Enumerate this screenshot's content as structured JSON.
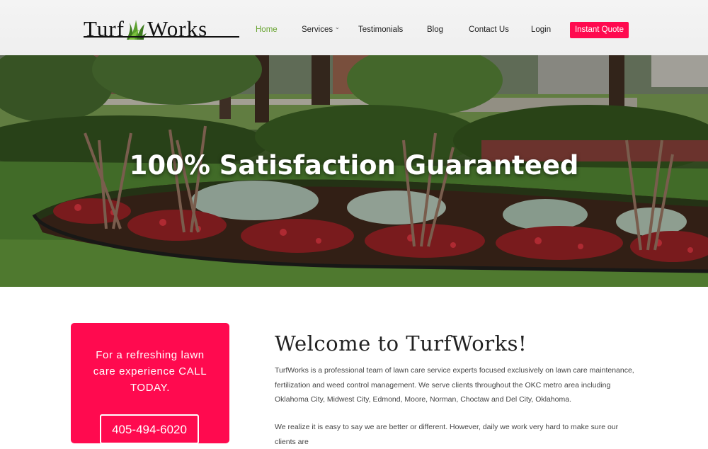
{
  "header": {
    "logo_left": "Turf",
    "logo_right": "Works",
    "nav": [
      {
        "label": "Home",
        "active": true
      },
      {
        "label": "Services",
        "has_dropdown": true
      },
      {
        "label": "Testimonials"
      },
      {
        "label": "Blog"
      },
      {
        "label": "Contact Us"
      },
      {
        "label": "Login"
      }
    ],
    "cta_label": "Instant Quote"
  },
  "hero": {
    "title": "100% Satisfaction Guaranteed"
  },
  "cta_box": {
    "text": "For a refreshing lawn care experience CALL TODAY.",
    "phone": "405-494-6020"
  },
  "welcome": {
    "title": "Welcome to TurfWorks!",
    "paragraph_1": "TurfWorks is a professional team of lawn care service experts focused exclusively on lawn care maintenance, fertilization and weed control management. We serve clients throughout the OKC metro area including Oklahoma City, Midwest City, Edmond, Moore, Norman, Choctaw and Del City, Oklahoma.",
    "paragraph_2": "We realize it is easy to say we are better or different. However, daily we work very hard to make sure our clients are"
  },
  "colors": {
    "accent_pink": "#ff0a4f",
    "nav_active": "#6aa533",
    "header_bg": "#f2f2f2"
  },
  "icons": {
    "logo_mark": "grass-tuft-icon",
    "dropdown": "chevron-down-icon"
  }
}
